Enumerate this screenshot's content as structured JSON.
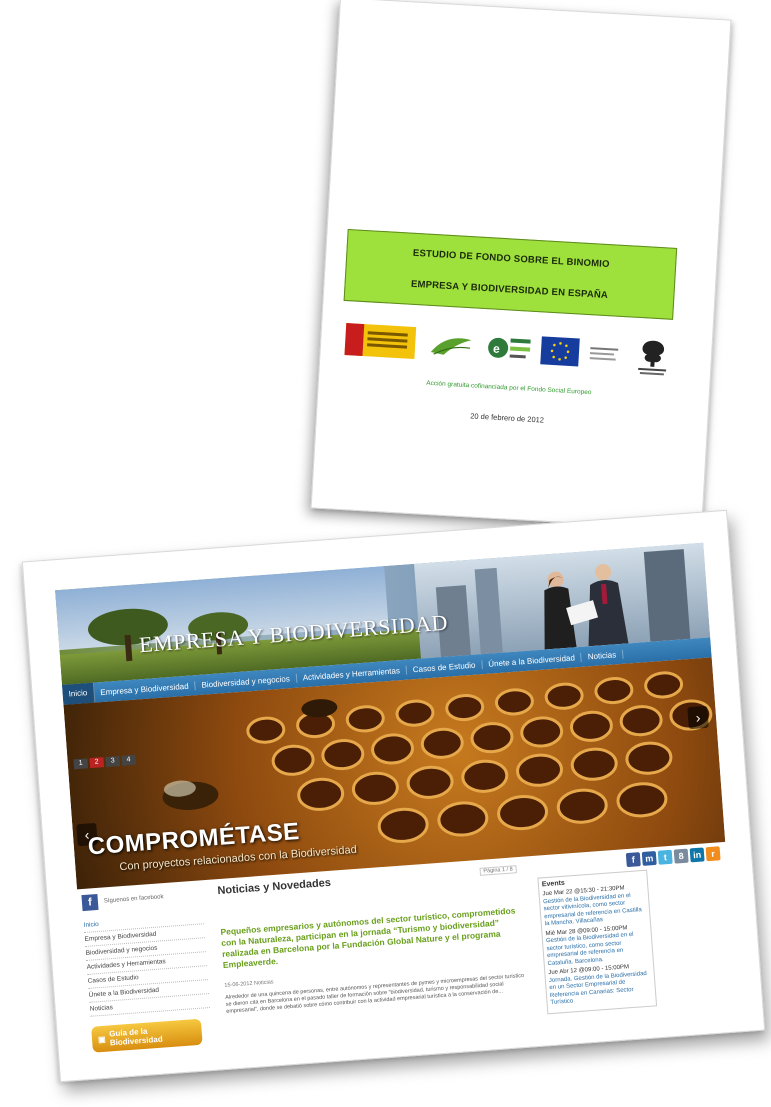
{
  "report": {
    "title_line1": "ESTUDIO DE FONDO SOBRE EL BINOMIO",
    "title_line2": "EMPRESA Y BIODIVERSIDAD EN ESPAÑA",
    "cofinanced_text": "Acción gratuita cofinanciada por el Fondo Social Europeo",
    "date": "20 de febrero de 2012",
    "logo_names": [
      "gobierno-de-espana-logo",
      "fundacion-biodiversidad-logo",
      "emplea-verde-logo",
      "union-europea-logo",
      "fundacion-global-nature-logo"
    ]
  },
  "website": {
    "banner_title": "EMPRESA Y BIODIVERSIDAD",
    "nav": [
      "Inicio",
      "Empresa y Biodiversidad",
      "Biodiversidad y negocios",
      "Actividades y Herramientas",
      "Casos de Estudio",
      "Únete a la Biodiversidad",
      "Noticias"
    ],
    "hero": {
      "pager": [
        "1",
        "2",
        "3",
        "4"
      ],
      "headline": "COMPROMÉTASE",
      "subtitle": "Con proyectos relacionados con la Biodiversidad"
    },
    "sidebar": {
      "facebook_label": "Síguenos en facebook",
      "links": [
        "Inicio",
        "Empresa y Biodiversidad",
        "Biodiversidad y negocios",
        "Actividades y Herramientas",
        "Casos de Estudio",
        "Únete a la Biodiversidad",
        "Noticias"
      ],
      "guia_label": "Guía de la Biodiversidad"
    },
    "news": {
      "heading": "Noticias y Novedades",
      "pagination": "Página 1 / 8",
      "title": "Pequeños empresarios y autónomos del sector turístico, comprometidos con la Naturaleza, participan en la jornada “Turismo y biodiversidad” realizada en Barcelona por la Fundación Global Nature y el programa Empleaverde.",
      "meta": "15-06-2012 Noticias",
      "body": "Alrededor de una quincena de personas, entre autónomos y representantes de pymes y microempresas del sector turístico se dieron cita en Barcelona en el pasado taller de formación sobre “biodiversidad, turismo y responsabilidad social empresarial”, donde se debatió sobre cómo contribuir con la actividad empresarial turística a la conservación de..."
    },
    "events": {
      "title": "Events",
      "items": [
        {
          "when": "Jue Mar 22 @15:30 - 21:30PM",
          "what": "Gestión de la Biodiversidad en el sector vitivinícola, como sector empresarial de referencia en Castilla la Mancha. Villacañas"
        },
        {
          "when": "Mié Mar 28 @09:00 - 15:00PM",
          "what": "Gestión de la Biodiversidad en el sector turístico, como sector empresarial de referencia en Cataluña. Barcelona."
        },
        {
          "when": "Jue Abr 12 @09:00 - 15:00PM",
          "what": "Jornada. Gestión de la Biodiversidad en un Sector Empresarial de Referencia en Canarias: Sector Turístico"
        }
      ]
    },
    "social_icons": [
      "facebook-icon",
      "myspace-icon",
      "twitter-icon",
      "flickr-icon",
      "linkedin-icon",
      "rss-icon"
    ]
  }
}
